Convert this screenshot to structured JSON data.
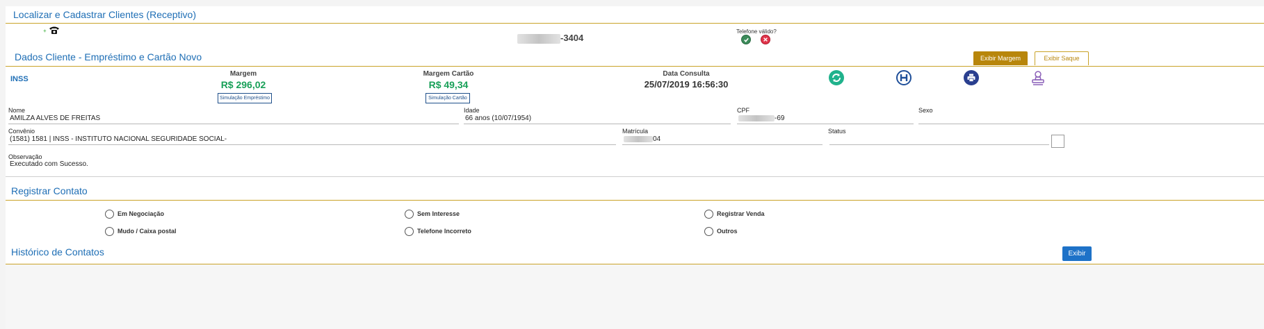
{
  "header": {
    "title": "Localizar e Cadastrar Clientes (Receptivo)",
    "phone_suffix": "-3404",
    "telefone_valido_label": "Telefone válido?"
  },
  "dados_cliente": {
    "title": "Dados Cliente - Empréstimo e Cartão Novo",
    "exibir_margem_label": "Exibir Margem",
    "exibir_saque_label": "Exibir Saque",
    "orgao": "INSS",
    "margem_label": "Margem",
    "margem_value": "R$ 296,02",
    "simulacao_emprestimo_label": "Simulação Empréstimo",
    "margem_cartao_label": "Margem Cartão",
    "margem_cartao_value": "R$ 49,34",
    "simulacao_cartao_label": "Simulação Cartão",
    "data_consulta_label": "Data Consulta",
    "data_consulta_value": "25/07/2019 16:56:30",
    "icons": [
      "refresh-icon",
      "h-circle-icon",
      "printer-icon",
      "stamp-icon"
    ],
    "colors": {
      "accent": "#c9a227",
      "primary": "#1e6eb5",
      "green": "#18a058",
      "button_gold": "#b8860b"
    }
  },
  "fields": {
    "nome_label": "Nome",
    "nome_value": "AMILZA ALVES DE FREITAS",
    "idade_label": "Idade",
    "idade_value": "66 anos (10/07/1954)",
    "cpf_label": "CPF",
    "cpf_suffix": "-69",
    "sexo_label": "Sexo",
    "sexo_value": "",
    "convenio_label": "Convênio",
    "convenio_value": "(1581) 1581 | INSS - INSTITUTO NACIONAL SEGURIDADE SOCIAL-",
    "matricula_label": "Matrícula",
    "matricula_suffix": "04",
    "status_label": "Status",
    "status_value": "",
    "observacao_label": "Observação",
    "observacao_value": "Executado com Sucesso."
  },
  "registrar_contato": {
    "title": "Registrar Contato",
    "options": [
      "Em Negociação",
      "Sem Interesse",
      "Registrar Venda",
      "Mudo / Caixa postal",
      "Telefone Incorreto",
      "Outros"
    ]
  },
  "historico": {
    "title": "Histórico de Contatos",
    "exibir_label": "Exibir"
  }
}
